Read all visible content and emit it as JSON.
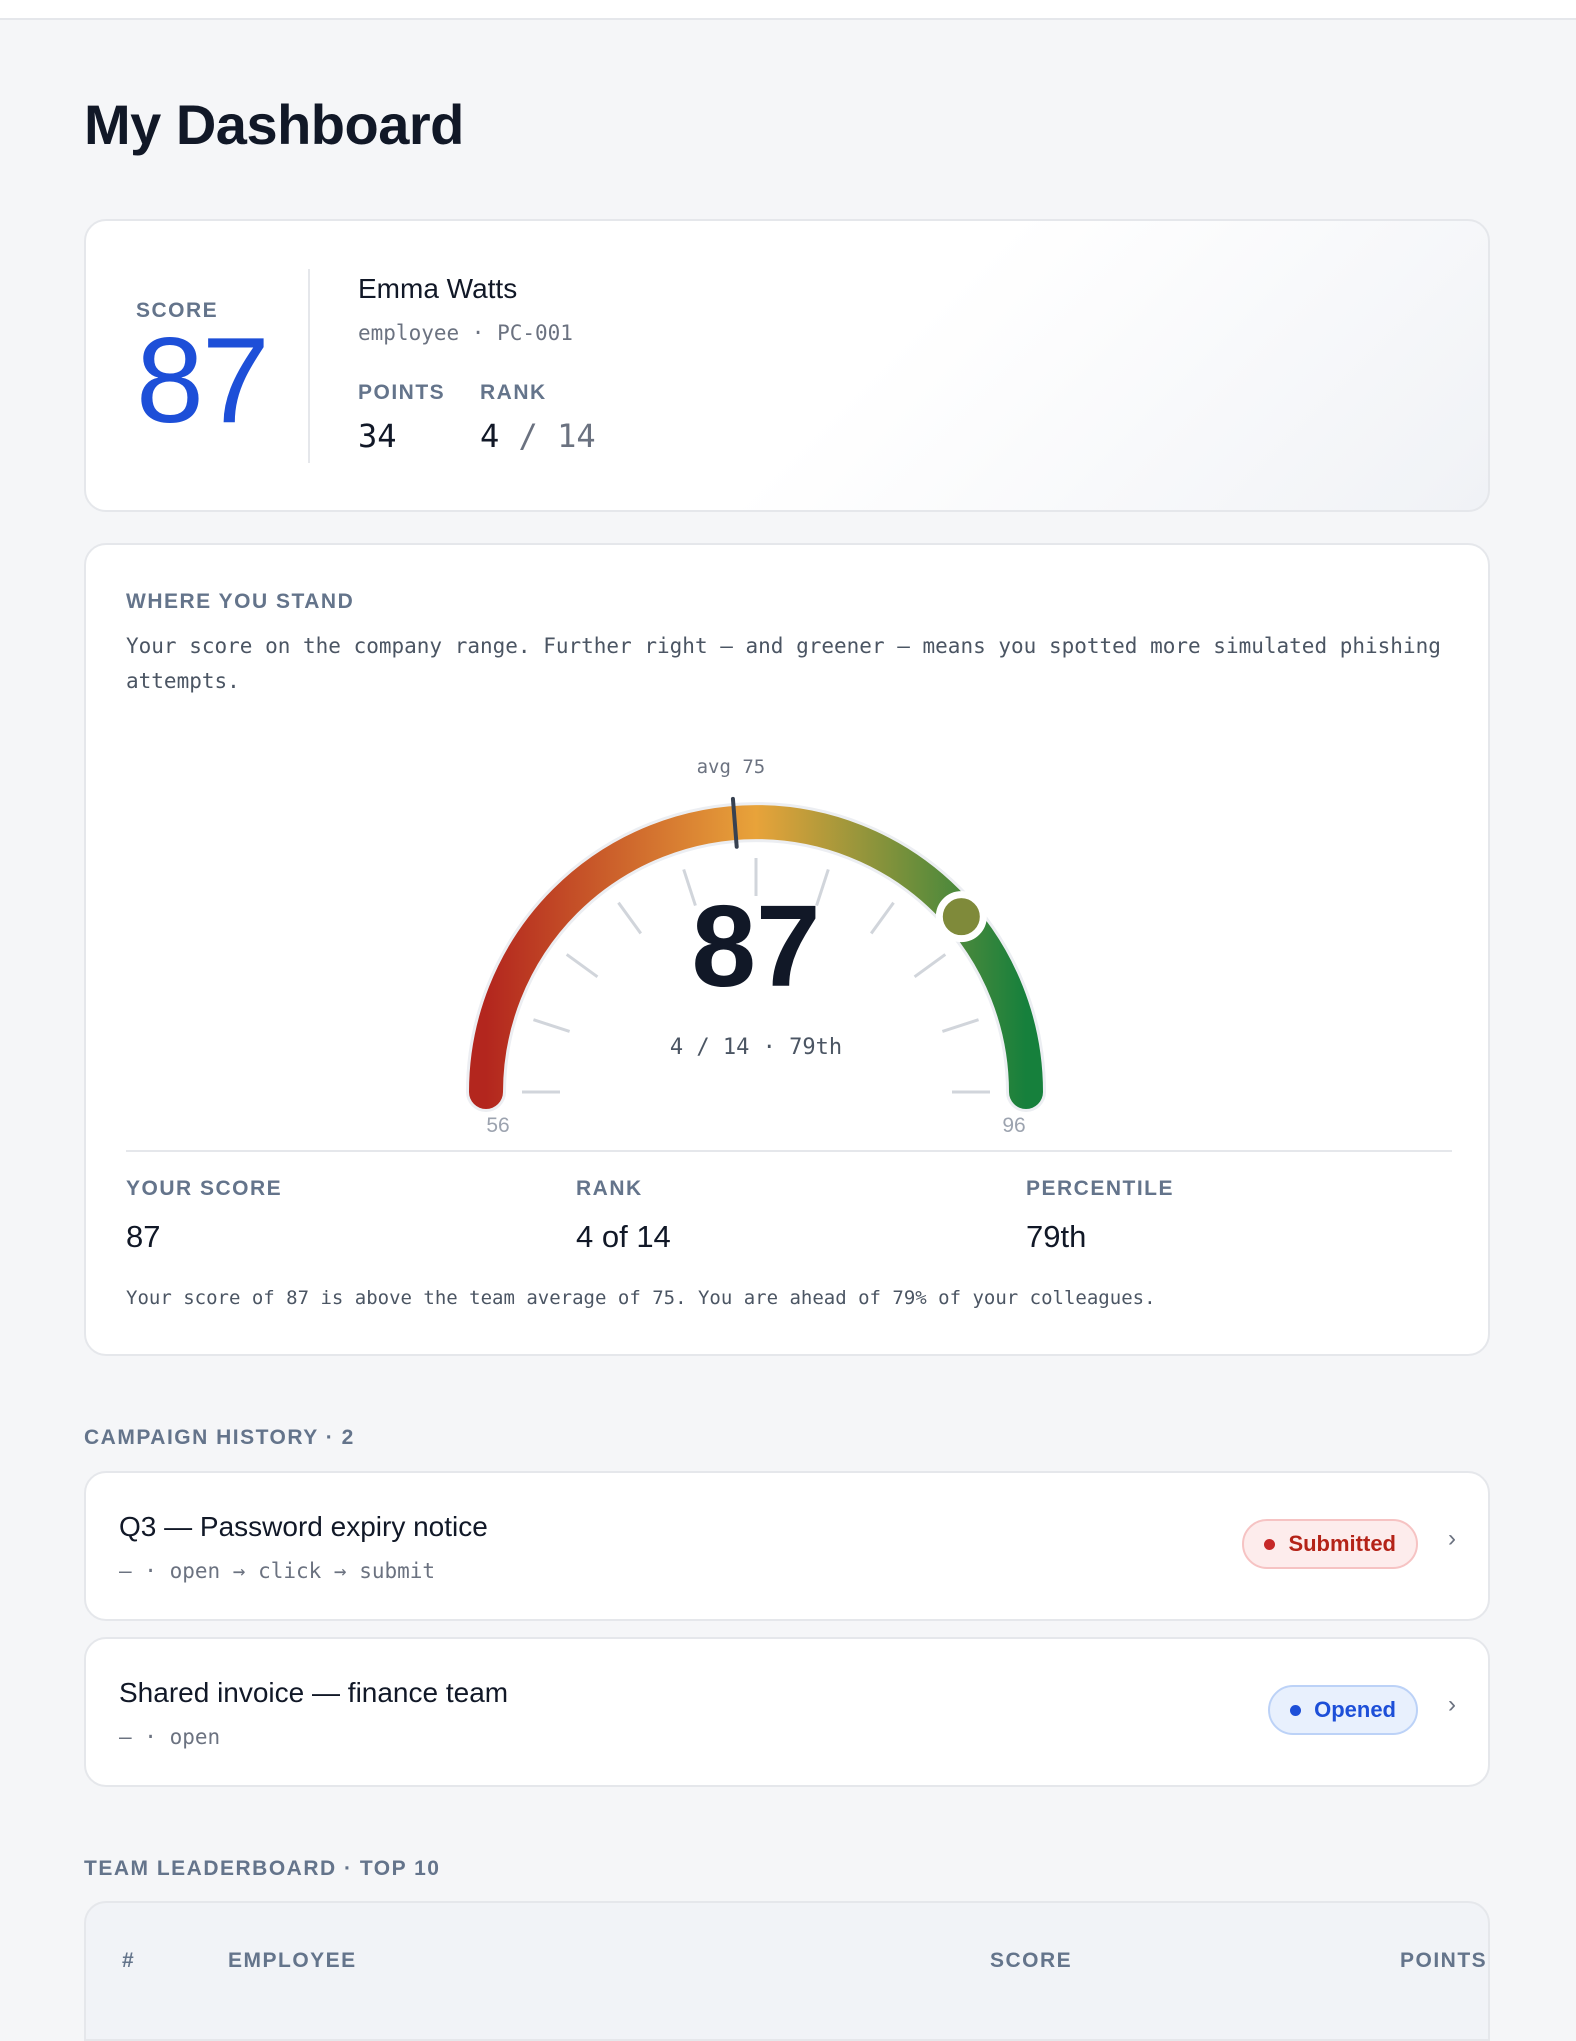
{
  "page": {
    "title": "My Dashboard"
  },
  "profile": {
    "score_label": "SCORE",
    "score": "87",
    "name": "Emma Watts",
    "meta": "employee · PC-001",
    "points_label": "POINTS",
    "points": "34",
    "rank_label": "RANK",
    "rank_position": "4",
    "rank_total": "/ 14"
  },
  "standing": {
    "title": "WHERE YOU STAND",
    "description": "Your score on the company range. Further right — and greener — means you spotted more simulated phishing attempts.",
    "gauge": {
      "min": 56,
      "max": 96,
      "avg": 75,
      "score": 87,
      "avg_label": "avg 75",
      "min_label": "56",
      "max_label": "96",
      "center_value": "87",
      "center_sub": "4 / 14 · 79th",
      "colors": {
        "low": "#b3261e",
        "mid": "#e8a33a",
        "high": "#16803c",
        "marker": "#7f8a3a"
      }
    },
    "stats": [
      {
        "label": "YOUR SCORE",
        "value": "87"
      },
      {
        "label": "RANK",
        "value": "4 of 14"
      },
      {
        "label": "PERCENTILE",
        "value": "79th"
      }
    ],
    "summary": "Your score of 87 is above the team average of 75. You are ahead of 79% of your colleagues."
  },
  "campaigns": {
    "label": "CAMPAIGN HISTORY · 2",
    "items": [
      {
        "title": "Q3 — Password expiry notice",
        "sub": "— · open → click → submit",
        "status": "Submitted",
        "status_color": "#b42318"
      },
      {
        "title": "Shared invoice — finance team",
        "sub": "— · open",
        "status": "Opened",
        "status_color": "#1d4fd8"
      }
    ],
    "chevron": "›"
  },
  "leaderboard": {
    "label": "TEAM LEADERBOARD · TOP 10",
    "columns": [
      "#",
      "EMPLOYEE",
      "SCORE",
      "POINTS"
    ]
  }
}
